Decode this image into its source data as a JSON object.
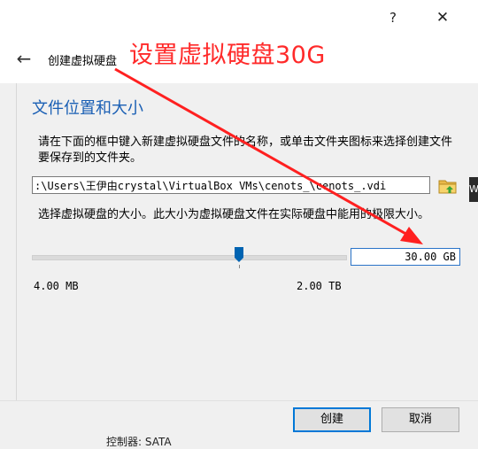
{
  "titlebar": {
    "help_label": "?",
    "close_label": "✕"
  },
  "header": {
    "back_icon": "back-arrow-icon",
    "page_title": "创建虚拟硬盘",
    "annotation": "设置虚拟硬盘30G"
  },
  "main": {
    "section_heading": "文件位置和大小",
    "location_description": "请在下面的框中键入新建虚拟硬盘文件的名称，或单击文件夹图标来选择创建文件要保存到的文件夹。",
    "file_path": ":\\Users\\王伊由crystal\\VirtualBox VMs\\cenots_\\cenots_.vdi",
    "folder_icon": "folder-icon",
    "size_description": "选择虚拟硬盘的大小。此大小为虚拟硬盘文件在实际硬盘中能用的极限大小。",
    "size_value": "30.00 GB",
    "slider_level": 0.66,
    "min_size_label": "4.00 MB",
    "max_size_label": "2.00 TB"
  },
  "footer": {
    "create_label": "创建",
    "cancel_label": "取消"
  },
  "background_peek": {
    "controller_text": "控制器: SATA",
    "side_letter": "W"
  },
  "colors": {
    "annotation_red": "#ff2a2a",
    "heading_blue": "#1a5fb4",
    "focus_blue": "#0078d7"
  }
}
